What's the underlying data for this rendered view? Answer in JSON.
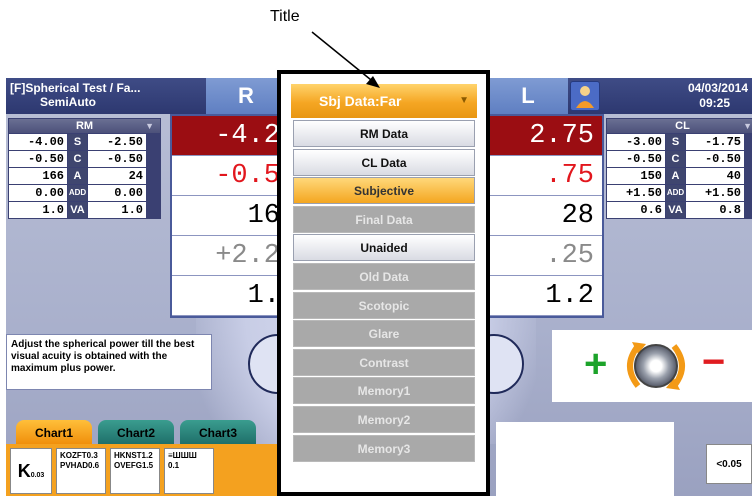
{
  "callout": {
    "label": "Title"
  },
  "topbar": {
    "mode_line1": "[F]Spherical Test / Fa...",
    "mode_line2": "SemiAuto",
    "eye_right": "R",
    "eye_left": "L",
    "date": "04/03/2014",
    "time": "09:25"
  },
  "left_table": {
    "title": "RM",
    "rows": [
      {
        "l": "-4.00",
        "tag": "S",
        "r": "-2.50"
      },
      {
        "l": "-0.50",
        "tag": "C",
        "r": "-0.50"
      },
      {
        "l": "166",
        "tag": "A",
        "r": "24"
      },
      {
        "l": "0.00",
        "tag": "ADD",
        "r": "0.00"
      },
      {
        "l": "1.0",
        "tag": "VA",
        "r": "1.0"
      }
    ]
  },
  "right_table": {
    "title": "CL",
    "rows": [
      {
        "l": "-3.00",
        "tag": "S",
        "r": "-1.75"
      },
      {
        "l": "-0.50",
        "tag": "C",
        "r": "-0.50"
      },
      {
        "l": "150",
        "tag": "A",
        "r": "40"
      },
      {
        "l": "+1.50",
        "tag": "ADD",
        "r": "+1.50"
      },
      {
        "l": "0.6",
        "tag": "VA",
        "r": "0.8"
      }
    ]
  },
  "right_eye_values": [
    "-4.2",
    "-0.5",
    "16",
    "+2.2",
    "1."
  ],
  "left_eye_values": [
    "2.75",
    ".75",
    "28",
    ".25",
    "1.2"
  ],
  "instruction": "Adjust the spherical power till the best visual acuity is obtained with the maximum plus power.",
  "dial": {
    "plus": "+",
    "minus": "−"
  },
  "chart_tabs": [
    "Chart1",
    "Chart2",
    "Chart3"
  ],
  "chart_cells": [
    {
      "main": "K",
      "sub": "0.03"
    },
    {
      "line1": "KOZFT0.3",
      "line2": "PVHAD0.6"
    },
    {
      "line1": "HKNST1.2",
      "line2": "OVEFG1.5"
    },
    {
      "line1": "≡ШШШ 0.1",
      "line2": ""
    }
  ],
  "va_button": "<0.05",
  "dropdown": {
    "title": "Sbj Data:Far",
    "items": [
      {
        "label": "RM Data",
        "state": "enabled"
      },
      {
        "label": "CL Data",
        "state": "enabled"
      },
      {
        "label": "Subjective",
        "state": "selected"
      },
      {
        "label": "Final Data",
        "state": "disabled"
      },
      {
        "label": "Unaided",
        "state": "enabled"
      },
      {
        "label": "Old Data",
        "state": "disabled"
      },
      {
        "label": "Scotopic",
        "state": "disabled"
      },
      {
        "label": "Glare",
        "state": "disabled"
      },
      {
        "label": "Contrast",
        "state": "disabled"
      },
      {
        "label": "Memory1",
        "state": "disabled"
      },
      {
        "label": "Memory2",
        "state": "disabled"
      },
      {
        "label": "Memory3",
        "state": "disabled"
      }
    ]
  },
  "colors": {
    "topbar": "#2d3870",
    "dropdown_title": "#f5a623",
    "selected_item": "#f4a620",
    "red_value_bg": "#9b0d12",
    "plus": "#1ca32a",
    "minus": "#e01c20"
  }
}
